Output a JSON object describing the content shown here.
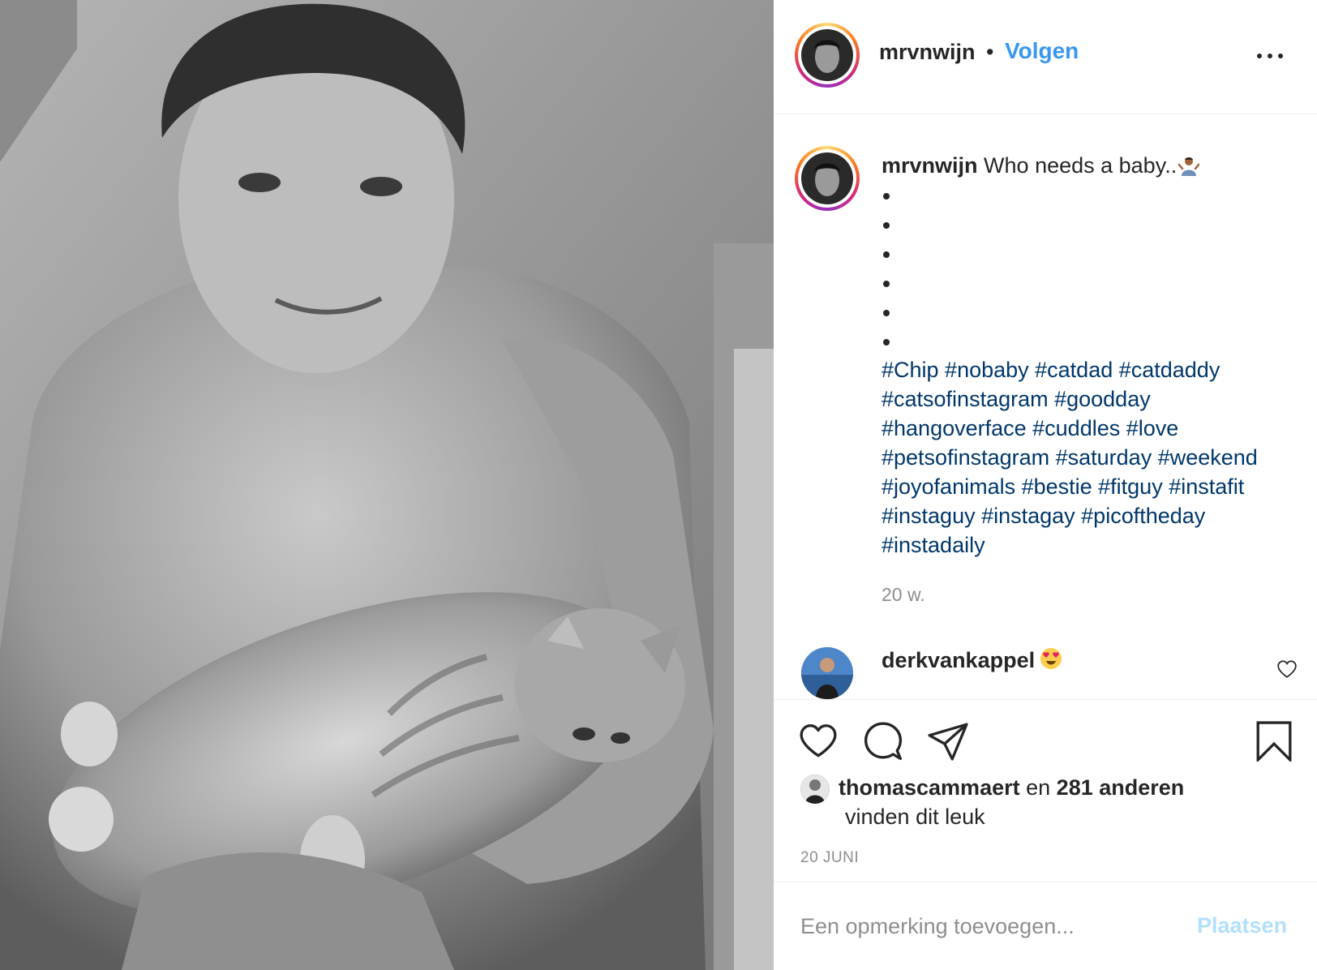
{
  "post": {
    "photo": {
      "alt": "",
      "style": "black-and-white"
    },
    "header": {
      "username": "mrvnwijn",
      "separator": "•",
      "follow_label": "Volgen",
      "more_icon": "more-horizontal-icon"
    },
    "caption": {
      "username": "mrvnwijn",
      "text": "Who needs a baby..",
      "emoji": "person-shrugging-emoji",
      "bullet_count": 6,
      "hashtag_lines": [
        "#Chip #nobaby #catdad #catdaddy",
        "#catsofinstagram #goodday",
        "#hangoverface #cuddles #love",
        "#petsofinstagram #saturday #weekend",
        "#joyofanimals #bestie #fitguy #instafit",
        "#instaguy #instagay #picoftheday",
        "#instadaily"
      ],
      "age": "20 w."
    },
    "comment": {
      "username": "derkvankappel",
      "emoji": "heart-eyes-emoji",
      "like_icon": "heart-outline-icon"
    },
    "actions": {
      "like_icon": "heart-outline-icon",
      "comment_icon": "speech-bubble-icon",
      "share_icon": "paper-plane-icon",
      "save_icon": "bookmark-icon"
    },
    "likes": {
      "first_user": "thomascammaert",
      "connector": "en",
      "others": "281 anderen",
      "suffix": "vinden dit leuk"
    },
    "date": "20 JUNI",
    "add_comment": {
      "placeholder": "Een opmerking toevoegen...",
      "post_label": "Plaatsen"
    },
    "colors": {
      "link_blue": "#3897f0",
      "hashtag_blue": "#00376b",
      "disabled_blue": "#b2dffc",
      "muted_gray": "#8e8e8e",
      "text": "#262626"
    }
  }
}
